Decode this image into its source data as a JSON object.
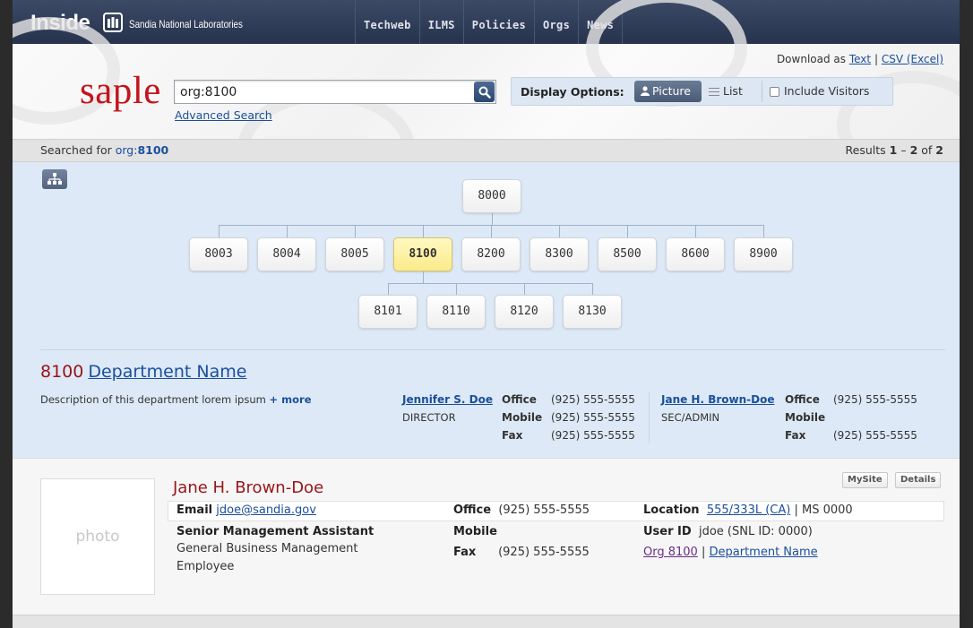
{
  "topbar": {
    "brand": "Inside",
    "lab_name": "Sandia National Laboratories",
    "nav": [
      "Techweb",
      "ILMS",
      "Policies",
      "Orgs",
      "News"
    ]
  },
  "download": {
    "label": "Download as",
    "text_link": "Text",
    "sep": "|",
    "csv_link": "CSV (Excel)"
  },
  "search": {
    "logo": "saple",
    "value": "org:8100",
    "advanced": "Advanced Search"
  },
  "display_options": {
    "label": "Display Options:",
    "picture": "Picture",
    "list": "List",
    "include_visitors": "Include Visitors"
  },
  "status": {
    "searched_for": "Searched for",
    "query_prefix": "org:",
    "query_value": "8100",
    "results_label": "Results",
    "range_start": "1",
    "range_sep": "–",
    "range_end": "2",
    "of": "of",
    "total": "2"
  },
  "org_tree": {
    "root": "8000",
    "level1": [
      "8003",
      "8004",
      "8005",
      "8100",
      "8200",
      "8300",
      "8500",
      "8600",
      "8900"
    ],
    "active": "8100",
    "level2": [
      "8101",
      "8110",
      "8120",
      "8130"
    ]
  },
  "department": {
    "number": "8100",
    "name": "Department Name",
    "description": "Description of this department lorem ipsum",
    "more": "+ more",
    "contacts": [
      {
        "name": "Jennifer S. Doe",
        "role": "DIRECTOR",
        "office_label": "Office",
        "office": "(925) 555-5555",
        "mobile_label": "Mobile",
        "mobile": "(925) 555-5555",
        "fax_label": "Fax",
        "fax": "(925) 555-5555"
      },
      {
        "name": "Jane H. Brown-Doe",
        "role": "SEC/ADMIN",
        "office_label": "Office",
        "office": "(925) 555-5555",
        "mobile_label": "Mobile",
        "mobile": "",
        "fax_label": "Fax",
        "fax": "(925) 555-5555"
      }
    ]
  },
  "person": {
    "photo": "photo",
    "name": "Jane H. Brown-Doe",
    "mysite": "MySite",
    "details": "Details",
    "email_label": "Email",
    "email": "jdoe@sandia.gov",
    "office_label": "Office",
    "office": "(925) 555-5555",
    "location_label": "Location",
    "location_link": "555/333L (CA)",
    "ms": "| MS 0000",
    "title": "Senior Management Assistant",
    "category": "General Business Management",
    "type": "Employee",
    "mobile_label": "Mobile",
    "fax_label": "Fax",
    "fax": "(925) 555-5555",
    "userid_label": "User ID",
    "userid": "jdoe (SNL ID: 0000)",
    "org_link": "Org 8100",
    "org_sep": "|",
    "dept_link": "Department Name"
  }
}
